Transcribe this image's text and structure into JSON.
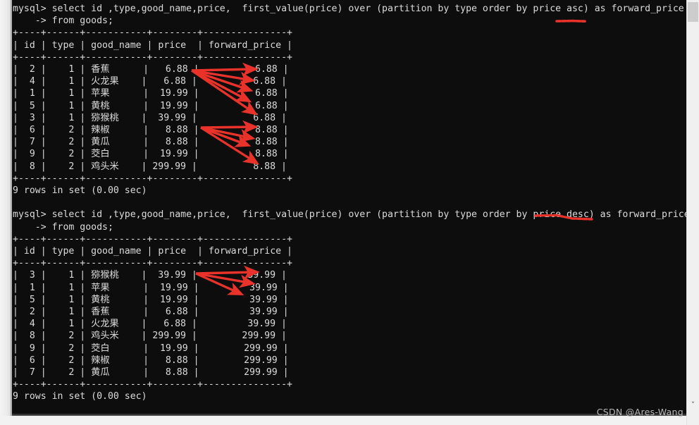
{
  "window": {
    "kind": "mysql-terminal",
    "background": "#0d0d0d",
    "foreground": "#d9d9d9",
    "watermark": "CSDN @Ares-Wang"
  },
  "scrollbar": {
    "thumb_label": "",
    "down_arrow": "˅"
  },
  "terminal": {
    "lines": [
      {
        "id": "q1-line1",
        "text": "mysql> select id ,type,good_name,price,  first_value(price) over (partition by type order by price asc) as forward_price"
      },
      {
        "id": "q1-line2",
        "text": "    -> from goods;"
      },
      {
        "id": "t1-top",
        "text": "+----+------+-----------+--------+---------------+"
      },
      {
        "id": "t1-head",
        "text": "| id | type | good_name | price  | forward_price |"
      },
      {
        "id": "t1-sep",
        "text": "+----+------+-----------+--------+---------------+"
      },
      {
        "id": "t1-r1",
        "text": "|  2 |    1 | 香蕉      |   6.88 |          6.88 |"
      },
      {
        "id": "t1-r2",
        "text": "|  4 |    1 | 火龙果    |   6.88 |          6.88 |"
      },
      {
        "id": "t1-r3",
        "text": "|  1 |    1 | 苹果      |  19.99 |          6.88 |"
      },
      {
        "id": "t1-r4",
        "text": "|  5 |    1 | 黄桃      |  19.99 |          6.88 |"
      },
      {
        "id": "t1-r5",
        "text": "|  3 |    1 | 猕猴桃    |  39.99 |          6.88 |"
      },
      {
        "id": "t1-r6",
        "text": "|  6 |    2 | 辣椒      |   8.88 |          8.88 |"
      },
      {
        "id": "t1-r7",
        "text": "|  7 |    2 | 黄瓜      |   8.88 |          8.88 |"
      },
      {
        "id": "t1-r8",
        "text": "|  9 |    2 | 茭白      |  19.99 |          8.88 |"
      },
      {
        "id": "t1-r9",
        "text": "|  8 |    2 | 鸡头米    | 299.99 |          8.88 |"
      },
      {
        "id": "t1-bot",
        "text": "+----+------+-----------+--------+---------------+"
      },
      {
        "id": "q1-rows",
        "text": "9 rows in set (0.00 sec)"
      },
      {
        "id": "blank1",
        "text": ""
      },
      {
        "id": "q2-line1",
        "text": "mysql> select id ,type,good_name,price,  first_value(price) over (partition by type order by price desc) as forward_price"
      },
      {
        "id": "q2-line2",
        "text": "    -> from goods;"
      },
      {
        "id": "t2-top",
        "text": "+----+------+-----------+--------+---------------+"
      },
      {
        "id": "t2-head",
        "text": "| id | type | good_name | price  | forward_price |"
      },
      {
        "id": "t2-sep",
        "text": "+----+------+-----------+--------+---------------+"
      },
      {
        "id": "t2-r1",
        "text": "|  3 |    1 | 猕猴桃    |  39.99 |         39.99 |"
      },
      {
        "id": "t2-r2",
        "text": "|  1 |    1 | 苹果      |  19.99 |         39.99 |"
      },
      {
        "id": "t2-r3",
        "text": "|  5 |    1 | 黄桃      |  19.99 |         39.99 |"
      },
      {
        "id": "t2-r4",
        "text": "|  2 |    1 | 香蕉      |   6.88 |         39.99 |"
      },
      {
        "id": "t2-r5",
        "text": "|  4 |    1 | 火龙果    |   6.88 |         39.99 |"
      },
      {
        "id": "t2-r6",
        "text": "|  8 |    2 | 鸡头米    | 299.99 |        299.99 |"
      },
      {
        "id": "t2-r7",
        "text": "|  9 |    2 | 茭白      |  19.99 |        299.99 |"
      },
      {
        "id": "t2-r8",
        "text": "|  6 |    2 | 辣椒      |   8.88 |        299.99 |"
      },
      {
        "id": "t2-r9",
        "text": "|  7 |    2 | 黄瓜      |   8.88 |        299.99 |"
      },
      {
        "id": "t2-bot",
        "text": "+----+------+-----------+--------+---------------+"
      },
      {
        "id": "q2-rows",
        "text": "9 rows in set (0.00 sec)"
      },
      {
        "id": "blank2",
        "text": ""
      },
      {
        "id": "prompt",
        "text": "mysql>"
      }
    ]
  },
  "queries": [
    {
      "name": "first-value-asc",
      "prompt": "mysql>",
      "sql": "select id ,type,good_name,price,  first_value(price) over (partition by type order by price asc) as forward_price",
      "continuation_prompt": "    ->",
      "continuation": "from goods;",
      "highlighted_keyword": "price asc",
      "result_footer": "9 rows in set (0.00 sec)",
      "columns": [
        "id",
        "type",
        "good_name",
        "price",
        "forward_price"
      ],
      "rows": [
        [
          "2",
          "1",
          "香蕉",
          "6.88",
          "6.88"
        ],
        [
          "4",
          "1",
          "火龙果",
          "6.88",
          "6.88"
        ],
        [
          "1",
          "1",
          "苹果",
          "19.99",
          "6.88"
        ],
        [
          "5",
          "1",
          "黄桃",
          "19.99",
          "6.88"
        ],
        [
          "3",
          "1",
          "猕猴桃",
          "39.99",
          "6.88"
        ],
        [
          "6",
          "2",
          "辣椒",
          "8.88",
          "8.88"
        ],
        [
          "7",
          "2",
          "黄瓜",
          "8.88",
          "8.88"
        ],
        [
          "9",
          "2",
          "茭白",
          "19.99",
          "8.88"
        ],
        [
          "8",
          "2",
          "鸡头米",
          "299.99",
          "8.88"
        ]
      ]
    },
    {
      "name": "first-value-desc",
      "prompt": "mysql>",
      "sql": "select id ,type,good_name,price,  first_value(price) over (partition by type order by price desc) as forward_price",
      "continuation_prompt": "    ->",
      "continuation": "from goods;",
      "highlighted_keyword": "price desc",
      "result_footer": "9 rows in set (0.00 sec)",
      "columns": [
        "id",
        "type",
        "good_name",
        "price",
        "forward_price"
      ],
      "rows": [
        [
          "3",
          "1",
          "猕猴桃",
          "39.99",
          "39.99"
        ],
        [
          "1",
          "1",
          "苹果",
          "19.99",
          "39.99"
        ],
        [
          "5",
          "1",
          "黄桃",
          "19.99",
          "39.99"
        ],
        [
          "2",
          "1",
          "香蕉",
          "6.88",
          "39.99"
        ],
        [
          "4",
          "1",
          "火龙果",
          "6.88",
          "39.99"
        ],
        [
          "8",
          "2",
          "鸡头米",
          "299.99",
          "299.99"
        ],
        [
          "9",
          "2",
          "茭白",
          "19.99",
          "299.99"
        ],
        [
          "6",
          "2",
          "辣椒",
          "8.88",
          "299.99"
        ],
        [
          "7",
          "2",
          "黄瓜",
          "8.88",
          "299.99"
        ]
      ]
    }
  ],
  "annotations": {
    "color": "#e8322a",
    "arrow_groups": [
      {
        "name": "table1-type1-arrows",
        "count": 5,
        "from": "price 6.88 row 1",
        "to": "forward_price rows 1-5"
      },
      {
        "name": "table1-type2-arrows",
        "count": 4,
        "from": "price 8.88 row 6",
        "to": "forward_price rows 6-9"
      },
      {
        "name": "table2-type1-arrows",
        "count": 3,
        "from": "price 39.99 row 1",
        "to": "forward_price rows 1-3"
      }
    ],
    "underlines": [
      {
        "name": "asc-underline",
        "target": "price asc"
      },
      {
        "name": "desc-underline",
        "target": "price desc"
      }
    ]
  }
}
